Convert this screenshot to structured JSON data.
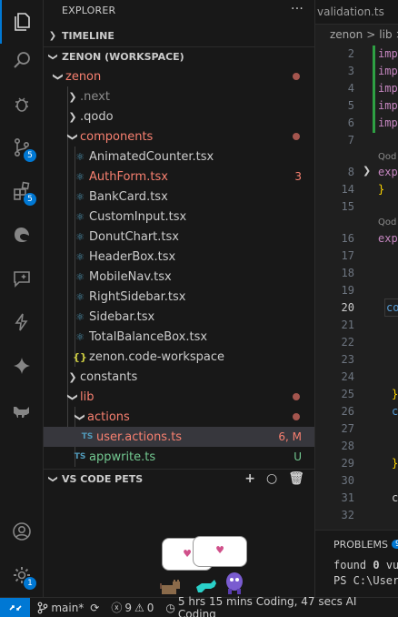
{
  "activity_bar": {
    "scm_badge": "5",
    "extensions_badge": "5",
    "manage_badge": "1"
  },
  "explorer": {
    "title": "EXPLORER",
    "more": "···",
    "timeline": "TIMELINE",
    "workspace": "ZENON (WORKSPACE)",
    "tree": {
      "zenon": "zenon",
      "next": ".next",
      "qodo": ".qodo",
      "components": "components",
      "files": [
        "AnimatedCounter.tsx",
        "AuthForm.tsx",
        "BankCard.tsx",
        "CustomInput.tsx",
        "DonutChart.tsx",
        "HeaderBox.tsx",
        "MobileNav.tsx",
        "RightSidebar.tsx",
        "Sidebar.tsx",
        "TotalBalanceBox.tsx"
      ],
      "authform_problems": "3",
      "workspace_file": "zenon.code-workspace",
      "workspace_icon": "{}",
      "constants": "constants",
      "lib": "lib",
      "actions": "actions",
      "user_actions": "user.actions.ts",
      "user_actions_status": "6, M",
      "appwrite": "appwrite.ts",
      "appwrite_status": "U",
      "ts_badge": "TS"
    }
  },
  "pets": {
    "title": "VS CODE PETS",
    "add_icon": "+",
    "circle_icon": "○",
    "trash_icon": "🗑",
    "heart": "♥"
  },
  "editor": {
    "tab": "validation.ts",
    "breadcrumb_root": "zenon",
    "breadcrumb_sep": ">",
    "breadcrumb_lib": "lib",
    "line_numbers": [
      "2",
      "3",
      "4",
      "5",
      "6",
      "7",
      "8",
      "14",
      "15",
      "16",
      "17",
      "18",
      "19",
      "20",
      "21",
      "22",
      "23",
      "24",
      "25",
      "26",
      "27",
      "28",
      "29",
      "30",
      "31",
      "32"
    ],
    "code_lines": {
      "l2": "imp",
      "l3": "imp",
      "l4": "imp",
      "l5": "imp",
      "l6": "imp",
      "l8": "exp",
      "l14": "}",
      "l16": "exp",
      "l20": "co",
      "l24": "}",
      "l25": "c",
      "l27": "}",
      "l31": "c"
    },
    "codelens_1": "Qod",
    "codelens_2": "Qod",
    "panel": {
      "tab": "PROBLEMS",
      "tab_badge": "9",
      "line1_a": "found ",
      "line1_b": "0",
      "line1_c": " vu",
      "line2": "PS C:\\User"
    }
  },
  "statusbar": {
    "remote_icon": "⨯",
    "branch": "main*",
    "errors": "9",
    "warnings": "0",
    "wakatime": "5 hrs 15 mins Coding, 47 secs AI Coding"
  }
}
